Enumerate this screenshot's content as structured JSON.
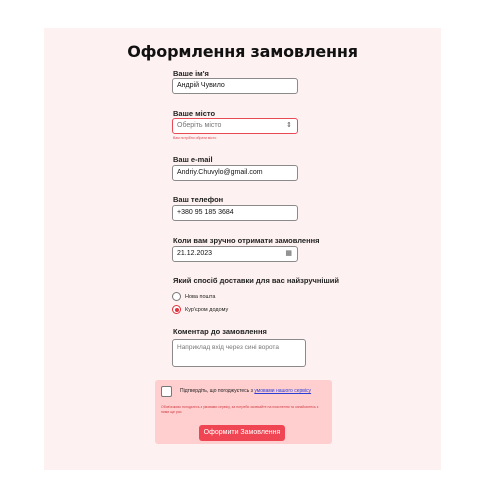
{
  "form": {
    "title": "Оформлення замовлення",
    "name": {
      "label": "Ваше ім'я",
      "value": "Андрій Чувило"
    },
    "city": {
      "label": "Ваше місто",
      "placeholder": "Оберіть місто",
      "error": "Вам потрібно обрати місто"
    },
    "email": {
      "label": "Ваш e-mail",
      "value": "Andriy.Chuvylo@gmail.com"
    },
    "phone": {
      "label": "Ваш телефон",
      "value": "+380 95 185 3684"
    },
    "date": {
      "label": "Коли вам зручно отримати замовлення",
      "value": "21.12.2023"
    },
    "delivery": {
      "label": "Який спосіб доставки для вас найзручніший",
      "options": [
        {
          "label": "Нова пошта",
          "selected": false
        },
        {
          "label": "Кур'єром додому",
          "selected": true
        }
      ]
    },
    "comment": {
      "label": "Коментар до замовлення",
      "placeholder": "Наприклад вхід через сині ворота"
    },
    "confirm": {
      "text": "Підтвердіть, що погоджуєтесь з",
      "link": "умовами нашого сервісу",
      "note": "Обов'язково погодьтесь з умовами сервісу, за потреби зачекайте на пояснення та ознайомтесь з ними ще раз"
    },
    "submit_label": "Оформити Замовлення"
  },
  "colors": {
    "accent": "#f04552",
    "panel": "#fdf2f1",
    "confirm_bg": "#ffcfcf"
  }
}
